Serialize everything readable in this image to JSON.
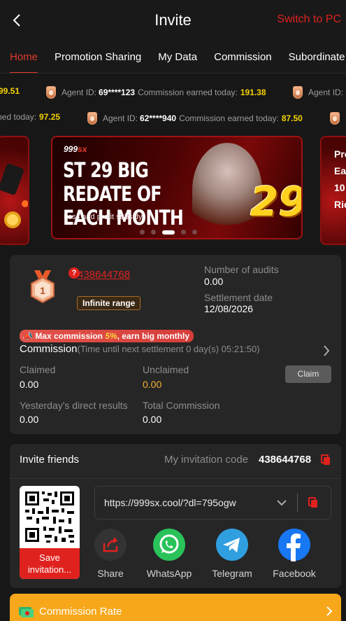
{
  "header": {
    "title": "Invite",
    "switch_label": "Switch to PC"
  },
  "tabs": [
    "Home",
    "Promotion Sharing",
    "My Data",
    "Commission",
    "Subordinate"
  ],
  "ticker": {
    "row1": [
      {
        "prefix": "",
        "id": "",
        "label": "",
        "amount": "99.51"
      },
      {
        "prefix": "Agent ID:",
        "id": "69****123",
        "label": "Commission earned today:",
        "amount": "191.38"
      },
      {
        "prefix": "Agent ID:",
        "id": "",
        "label": "",
        "amount": ""
      }
    ],
    "row2": [
      {
        "prefix": "",
        "id": "",
        "label": "ned today:",
        "amount": "97.25"
      },
      {
        "prefix": "Agent ID:",
        "id": "62****940",
        "label": "Commission earned today:",
        "amount": "87.50"
      }
    ]
  },
  "banner": {
    "logo": "999",
    "logo_suffix": "sx",
    "headline": "ST 29 BIG REDATE OF EACH MONTH",
    "subtitle": "Loss and profit subsidy",
    "big_number": "29",
    "right_peek": "Pro Ea 10 Ric"
  },
  "agent": {
    "id": "438644768",
    "range_label": "Infinite range",
    "level": "1",
    "audits_label": "Number of audits",
    "audits_value": "0.00",
    "settlement_label": "Settlement date",
    "settlement_value": "12/08/2026"
  },
  "commission": {
    "promo_prefix": "Max commission ",
    "promo_highlight": "5%",
    "promo_suffix": ", earn big monthly",
    "title": "Commission",
    "note": "(Time until next settlement  0 day(s) 05:21:50)",
    "claimed_label": "Claimed",
    "claimed_value": "0.00",
    "unclaimed_label": "Unclaimed",
    "unclaimed_value": "0.00",
    "claim_button": "Claim",
    "yesterday_label": "Yesterday's direct results",
    "yesterday_value": "0.00",
    "total_label": "Total Commission",
    "total_value": "0.00"
  },
  "invite": {
    "title": "Invite friends",
    "code_label": "My invitation code",
    "code_value": "438644768",
    "link": "https://999sx.cool/?dl=795ogw",
    "save_label": "Save invitation...",
    "share_items": [
      {
        "label": "Share",
        "icon": "share-icon"
      },
      {
        "label": "WhatsApp",
        "icon": "whatsapp-icon"
      },
      {
        "label": "Telegram",
        "icon": "telegram-icon"
      },
      {
        "label": "Facebook",
        "icon": "facebook-icon"
      }
    ]
  },
  "rate_bar": {
    "label": "Commission Rate"
  },
  "colors": {
    "accent": "#e0221e",
    "gold": "#f7a81a",
    "amount": "#f5d300",
    "card": "#262626",
    "bg": "#171717"
  }
}
